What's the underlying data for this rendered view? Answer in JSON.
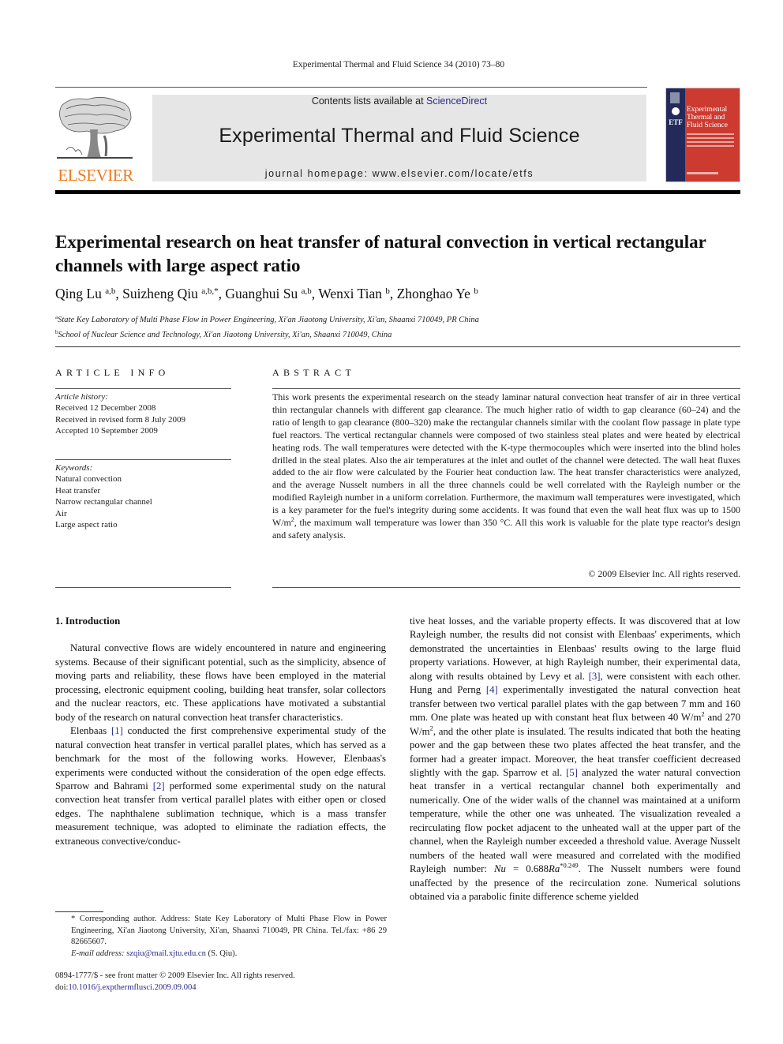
{
  "running_head": "Experimental Thermal and Fluid Science 34 (2010) 73–80",
  "header": {
    "publisher_logo_text": "ELSEVIER",
    "contents_prefix": "Contents lists available at ",
    "contents_link": "ScienceDirect",
    "journal_title": "Experimental Thermal and Fluid Science",
    "homepage": "journal homepage: www.elsevier.com/locate/etfs",
    "cover": {
      "title": "Experimental Thermal and Fluid Science",
      "side_label": "ETF",
      "colors": {
        "main": "#cc3a30",
        "strip": "#232a5a"
      }
    },
    "colors": {
      "logo": "#f07a1a",
      "masthead_bg": "#e6e6e6",
      "link": "#2a2a8c"
    }
  },
  "article": {
    "title": "Experimental research on heat transfer of natural convection in vertical rectangular channels with large aspect ratio",
    "authors": [
      {
        "name": "Qing Lu",
        "sup": "a,b",
        "sep": ", "
      },
      {
        "name": "Suizheng Qiu",
        "sup": "a,b,*",
        "sep": ", "
      },
      {
        "name": "Guanghui Su",
        "sup": "a,b",
        "sep": ", "
      },
      {
        "name": "Wenxi Tian",
        "sup": "b",
        "sep": ", "
      },
      {
        "name": "Zhonghao Ye",
        "sup": "b",
        "sep": ""
      }
    ],
    "affiliations": [
      {
        "mark": "a",
        "text": "State Key Laboratory of Multi Phase Flow in Power Engineering, Xi'an Jiaotong University, Xi'an, Shaanxi 710049, PR China"
      },
      {
        "mark": "b",
        "text": "School of Nuclear Science and Technology, Xi'an Jiaotong University, Xi'an, Shaanxi 710049, China"
      }
    ]
  },
  "article_info": {
    "heading": "ARTICLE INFO",
    "history_label": "Article history:",
    "history": [
      "Received 12 December 2008",
      "Received in revised form 8 July 2009",
      "Accepted 10 September 2009"
    ],
    "keywords_label": "Keywords:",
    "keywords": [
      "Natural convection",
      "Heat transfer",
      "Narrow rectangular channel",
      "Air",
      "Large aspect ratio"
    ]
  },
  "abstract": {
    "heading": "ABSTRACT",
    "text_1": "This work presents the experimental research on the steady laminar natural convection heat transfer of air in three vertical thin rectangular channels with different gap clearance. The much higher ratio of width to gap clearance (60–24) and the ratio of length to gap clearance (800–320) make the rectangular channels similar with the coolant flow passage in plate type fuel reactors. The vertical rectangular channels were composed of two stainless steal plates and were heated by electrical heating rods. The wall temperatures were detected with the K-type thermocouples which were inserted into the blind holes drilled in the steal plates. Also the air temperatures at the inlet and outlet of the channel were detected. The wall heat fluxes added to the air flow were calculated by the Fourier heat conduction law. The heat transfer characteristics were analyzed, and the average Nusselt numbers in all the three channels could be well correlated with the Rayleigh number or the modified Rayleigh number in a uniform correlation. Furthermore, the maximum wall temperatures were investigated, which is a key parameter for the fuel's integrity during some accidents. It was found that even the wall heat flux was up to 1500 W/m",
    "sup_1": "2",
    "text_2": ", the maximum wall temperature was lower than 350 °C. All this work is valuable for the plate type reactor's design and safety analysis.",
    "copyright": "© 2009 Elsevier Inc. All rights reserved."
  },
  "body": {
    "section_heading": "1. Introduction",
    "p1": "Natural convective flows are widely encountered in nature and engineering systems. Because of their significant potential, such as the simplicity, absence of moving parts and reliability, these flows have been employed in the material processing, electronic equipment cooling, building heat transfer, solar collectors and the nuclear reactors, etc. These applications have motivated a substantial body of the research on natural convection heat transfer characteristics.",
    "p2": {
      "a": "Elenbaas ",
      "ref1": "[1]",
      "b": " conducted the first comprehensive experimental study of the natural convection heat transfer in vertical parallel plates, which has served as a benchmark for the most of the following works. However, Elenbaas's experiments were conducted without the consideration of the open edge effects. Sparrow and Bahrami ",
      "ref2": "[2]",
      "c": " performed some experimental study on the natural convection heat transfer from vertical parallel plates with either open or closed edges. The naphthalene sublimation technique, which is a mass transfer measurement technique, was adopted to eliminate the radiation effects, the extraneous convective/conductive heat losses, and the variable property effects. It was discovered that at low Rayleigh number, the results did not consist with Elenbaas' experiments, which demonstrated the uncertainties in Elenbaas' results owing to the large fluid property variations. However, at high Rayleigh number, their experimental data, along with results obtained by Levy et al. ",
      "ref3": "[3]",
      "d": ", were consistent with each other. Hung and Perng ",
      "ref4": "[4]",
      "e": " experimentally investigated the natural convection heat transfer between two vertical parallel plates with the gap between 7 mm and 160 mm. One plate was heated up with constant heat flux between 40 W/m",
      "sup_a": "2",
      "f": " and 270 W/m",
      "sup_b": "2",
      "g": ", and the other plate is insulated. The results indicated that both the heating power and the gap between these two plates affected the heat transfer, and the former had a greater impact. Moreover, the heat transfer coefficient decreased slightly with the gap. Sparrow et al. ",
      "ref5": "[5]",
      "h": " analyzed the water natural convection heat transfer in a vertical rectangular channel both experimentally and numerically. One of the wider walls of the channel was maintained at a uniform temperature, while the other one was unheated. The visualization revealed a recirculating flow pocket adjacent to the unheated wall at the upper part of the channel, when the Rayleigh number exceeded a threshold value. Average Nusselt numbers of the heated wall were measured and correlated with the modified Rayleigh number: ",
      "eq_lhs": "Nu",
      "eq_mid": " = 0.688",
      "eq_ra": "Ra",
      "eq_exp": "*0.249",
      "i": ". The Nusselt numbers were found unaffected by the presence of the recirculation zone. Numerical solutions obtained via a parabolic finite difference scheme yielded"
    }
  },
  "footnotes": {
    "corresponding": "* Corresponding author. Address: State Key Laboratory of Multi Phase Flow in Power Engineering, Xi'an Jiaotong University, Xi'an, Shaanxi 710049, PR China. Tel./fax: +86 29 82665607.",
    "email_label": "E-mail address: ",
    "email": "szqiu@mail.xjtu.edu.cn",
    "email_suffix": " (S. Qiu).",
    "front_matter": "0894-1777/$ - see front matter © 2009 Elsevier Inc. All rights reserved.",
    "doi_prefix": "doi:",
    "doi": "10.1016/j.expthermflusci.2009.09.004"
  }
}
